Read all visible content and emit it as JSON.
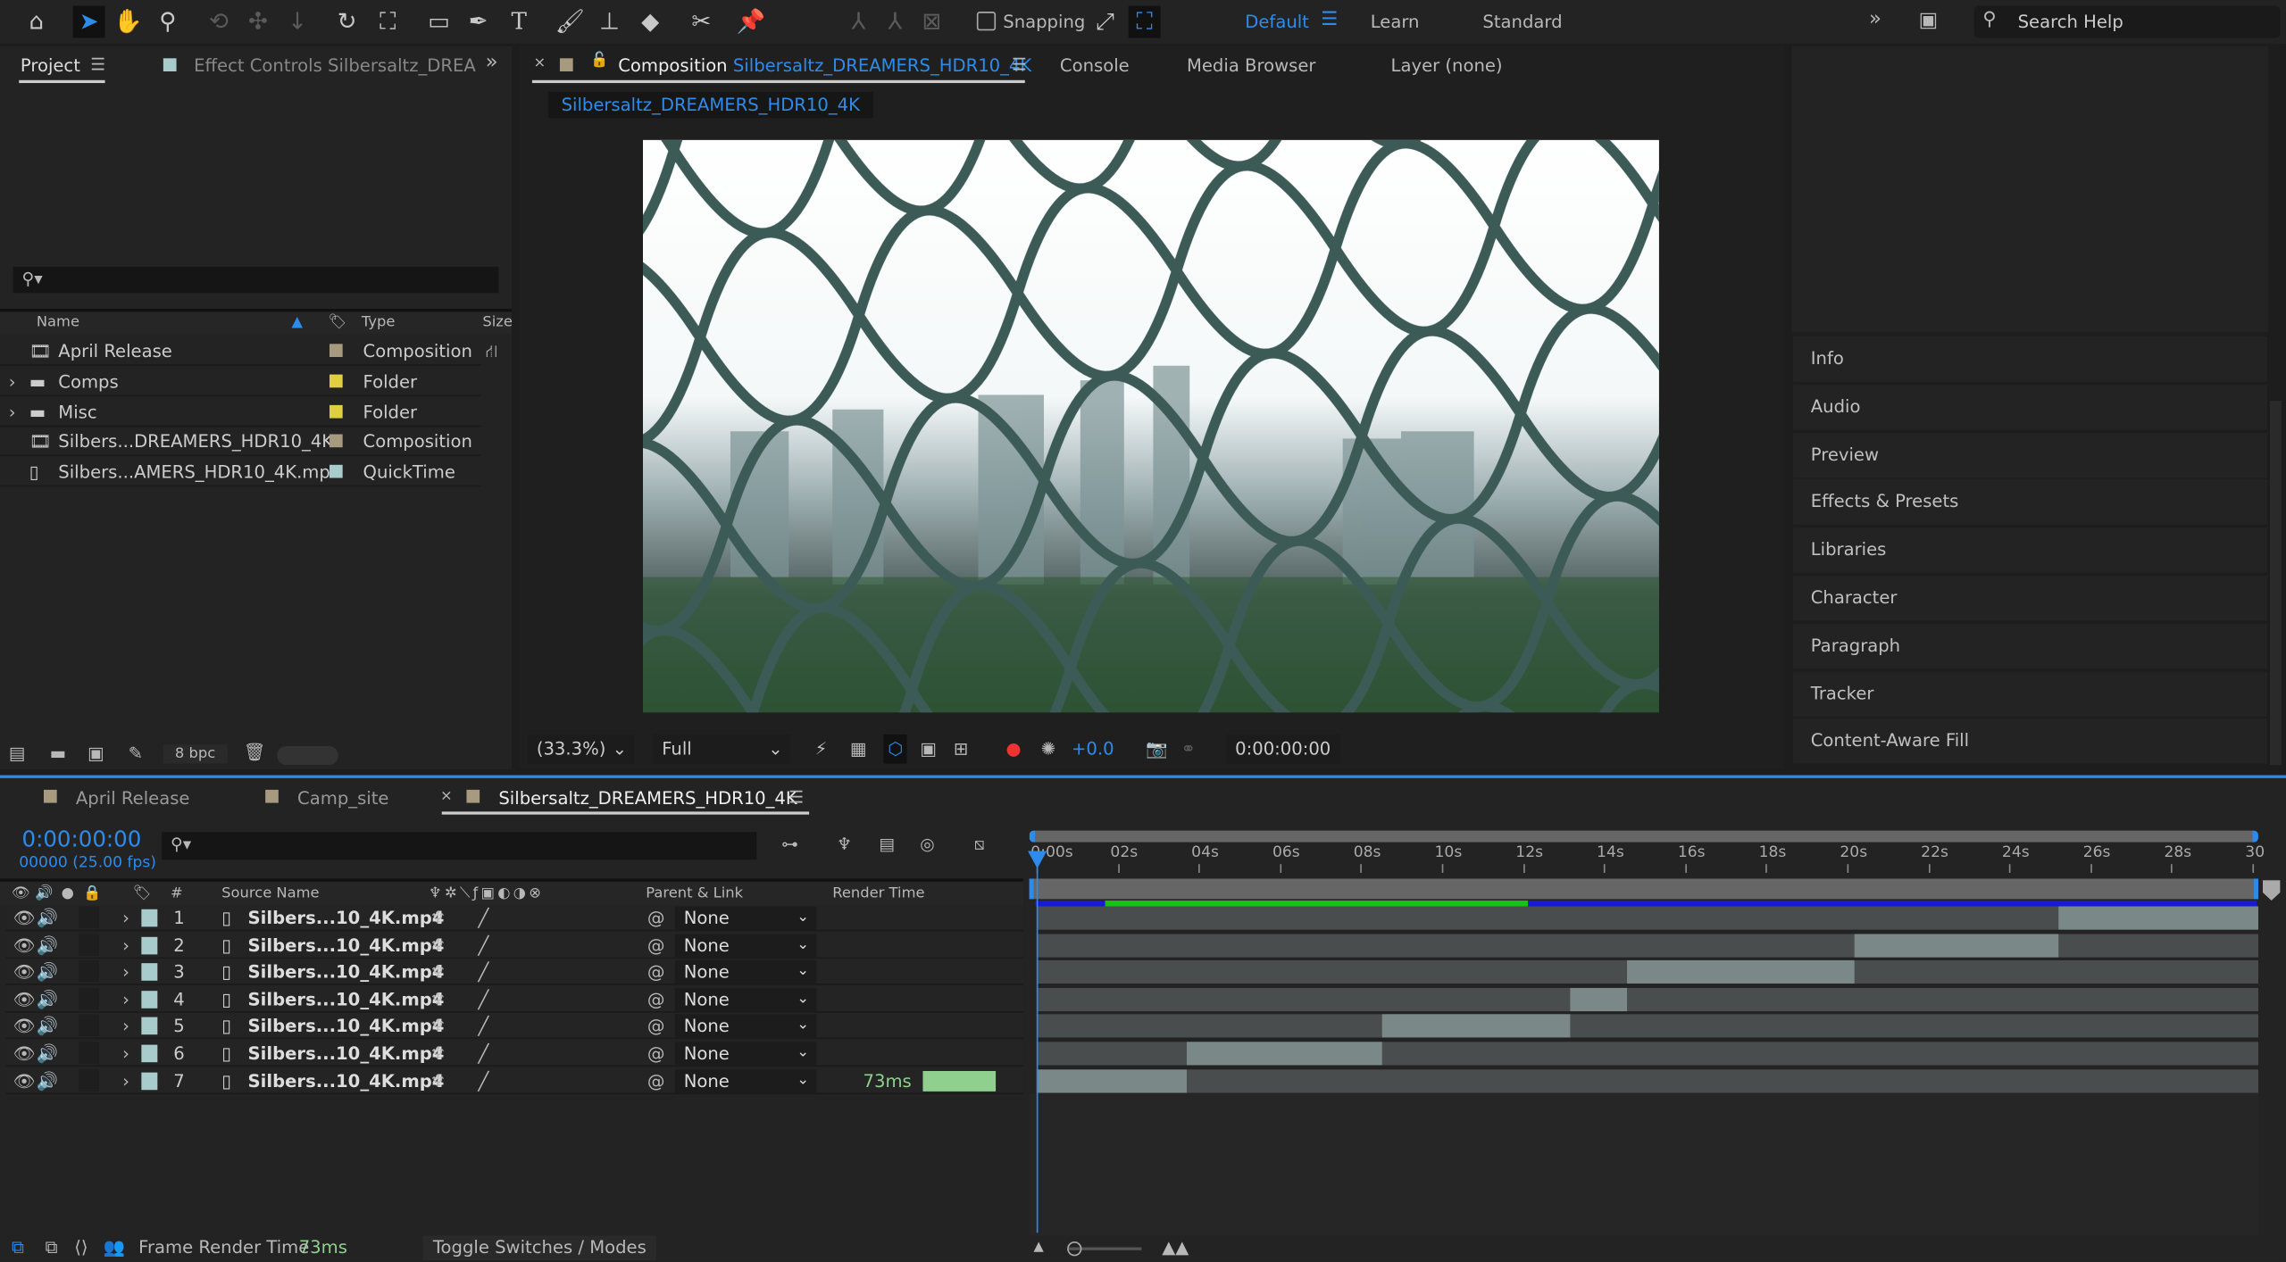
{
  "toolbar": {
    "snapping_label": "Snapping",
    "workspaces": [
      "Default",
      "Learn",
      "Standard"
    ],
    "active_workspace": "Default",
    "search_placeholder": "Search Help",
    "accent": "#2d8ceb"
  },
  "project_panel": {
    "tabs": [
      "Project",
      "Effect Controls Silbersaltz_DREA"
    ],
    "columns": [
      "Name",
      "Type",
      "Size"
    ],
    "items": [
      {
        "name": "April Release",
        "type": "Composition",
        "label_color": "#a89a7e",
        "icon": "composition-icon",
        "expandable": false
      },
      {
        "name": "Comps",
        "type": "Folder",
        "label_color": "#e0d040",
        "icon": "folder-icon",
        "expandable": true
      },
      {
        "name": "Misc",
        "type": "Folder",
        "label_color": "#e0d040",
        "icon": "folder-icon",
        "expandable": true
      },
      {
        "name": "Silbers...DREAMERS_HDR10_4K",
        "type": "Composition",
        "label_color": "#a89a7e",
        "icon": "composition-icon",
        "expandable": false
      },
      {
        "name": "Silbers...AMERS_HDR10_4K.mp4",
        "type": "QuickTime",
        "label_color": "#a8cccc",
        "icon": "footage-icon",
        "expandable": false
      }
    ],
    "bpc": "8 bpc"
  },
  "viewer": {
    "tabs": {
      "composition_prefix": "Composition",
      "composition_name": "Silbersaltz_DREAMERS_HDR10_4K",
      "console": "Console",
      "media_browser": "Media Browser",
      "layer": "Layer (none)"
    },
    "breadcrumb": "Silbersaltz_DREAMERS_HDR10_4K",
    "zoom": "(33.3%)",
    "resolution": "Full",
    "exposure": "+0.0",
    "timecode": "0:00:00:00"
  },
  "right_panel": {
    "items": [
      "Info",
      "Audio",
      "Preview",
      "Effects & Presets",
      "Libraries",
      "Character",
      "Paragraph",
      "Tracker",
      "Content-Aware Fill"
    ]
  },
  "timeline": {
    "tabs": [
      "April Release",
      "Camp_site",
      "Silbersaltz_DREAMERS_HDR10_4K"
    ],
    "active_tab": "Silbersaltz_DREAMERS_HDR10_4K",
    "timecode": "0:00:00:00",
    "frame_info": "00000 (25.00 fps)",
    "columns": {
      "number": "#",
      "source_name": "Source Name",
      "parent": "Parent & Link",
      "render_time": "Render Time"
    },
    "ruler": [
      "0:00s",
      "02s",
      "04s",
      "06s",
      "08s",
      "10s",
      "12s",
      "14s",
      "16s",
      "18s",
      "20s",
      "22s",
      "24s",
      "26s",
      "28s",
      "30"
    ],
    "duration_s": 30,
    "layers": [
      {
        "num": "1",
        "name": "Silbers...10_4K.mp4",
        "parent": "None",
        "render_time": "",
        "in": 25.1,
        "out": 30
      },
      {
        "num": "2",
        "name": "Silbers...10_4K.mp4",
        "parent": "None",
        "render_time": "",
        "in": 20.1,
        "out": 25.1
      },
      {
        "num": "3",
        "name": "Silbers...10_4K.mp4",
        "parent": "None",
        "render_time": "",
        "in": 14.5,
        "out": 20.1
      },
      {
        "num": "4",
        "name": "Silbers...10_4K.mp4",
        "parent": "None",
        "render_time": "",
        "in": 13.1,
        "out": 14.5
      },
      {
        "num": "5",
        "name": "Silbers...10_4K.mp4",
        "parent": "None",
        "render_time": "",
        "in": 8.5,
        "out": 13.1
      },
      {
        "num": "6",
        "name": "Silbers...10_4K.mp4",
        "parent": "None",
        "render_time": "",
        "in": 3.7,
        "out": 8.5
      },
      {
        "num": "7",
        "name": "Silbers...10_4K.mp4",
        "parent": "None",
        "render_time": "73ms",
        "in": 0,
        "out": 3.7
      }
    ],
    "status": {
      "frame_render_label": "Frame Render Time",
      "frame_render_value": "73ms",
      "toggle": "Toggle Switches / Modes"
    }
  }
}
